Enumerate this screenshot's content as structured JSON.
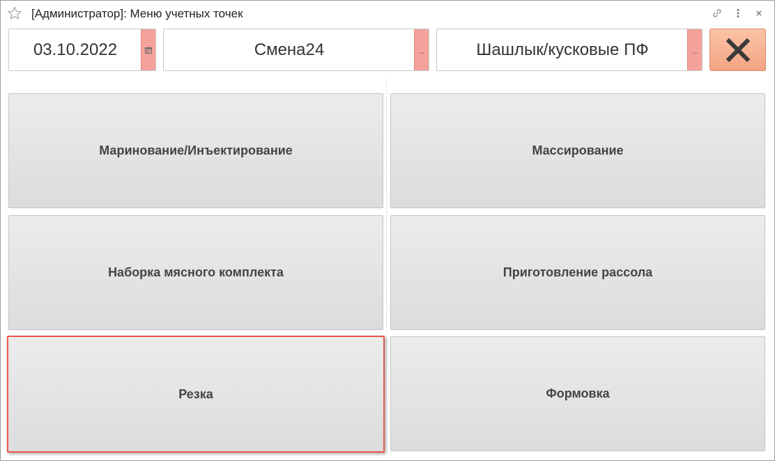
{
  "window": {
    "title": "[Администратор]: Меню учетных точек"
  },
  "titlebar_icons": [
    "star-icon",
    "link-icon",
    "more-vertical-icon",
    "close-icon"
  ],
  "header": {
    "date_value": "03.10.2022",
    "date_button_icon": "calendar-icon",
    "shift_value": "Смена24",
    "shift_button_label": "...",
    "product_value": "Шашлык/кусковые ПФ",
    "product_button_label": "...",
    "close_button_icon": "close-x-icon"
  },
  "tiles": [
    {
      "label": "Маринование/Инъектирование"
    },
    {
      "label": "Массирование"
    },
    {
      "label": "Наборка мясного комплекта"
    },
    {
      "label": "Приготовление рассола"
    },
    {
      "label": "Резка",
      "selected": true
    },
    {
      "label": "Формовка"
    }
  ],
  "colors": {
    "accent_button": "#f4a29b",
    "close_button": "#f4a383",
    "selection_border": "#e8584a",
    "tile_background": "#e4e4e4"
  }
}
